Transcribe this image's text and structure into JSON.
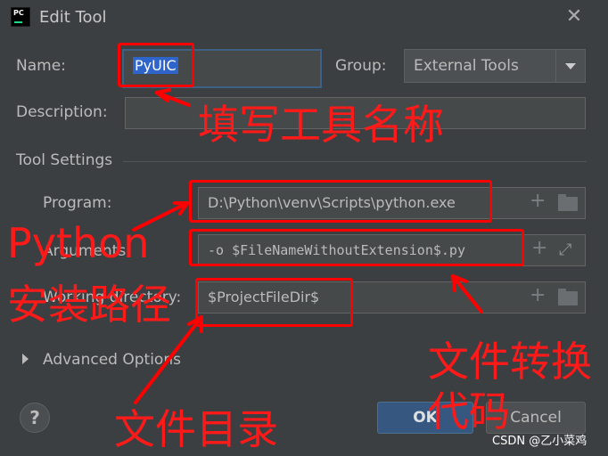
{
  "window": {
    "title": "Edit Tool",
    "close_glyph": "✕"
  },
  "form": {
    "name_label": "Name:",
    "name_value": "PyUIC",
    "group_label": "Group:",
    "group_value": "External Tools",
    "description_label": "Description:",
    "description_value": "",
    "section_title": "Tool Settings",
    "program_label": "Program:",
    "program_value": "D:\\Python\\venv\\Scripts\\python.exe",
    "arguments_label": "Arguments:",
    "arguments_value": "-o $FileNameWithoutExtension$.py",
    "workdir_label": "Working directory:",
    "workdir_value": "$ProjectFileDir$",
    "advanced_label": "Advanced Options"
  },
  "buttons": {
    "help": "?",
    "ok": "OK",
    "cancel": "Cancel"
  },
  "annotations": {
    "name_hint": "填写工具名称",
    "python_line1": "Python",
    "python_line2": "安装路径",
    "convert_line1": "文件转换",
    "convert_line2": "代码",
    "dir_hint": "文件目录"
  },
  "watermark": "CSDN @乙小菜鸡",
  "colors": {
    "background": "#3c3f41",
    "annotation": "#ff0000",
    "selection": "#2f65ca"
  },
  "icons": [
    "pycharm-app-icon",
    "close-icon",
    "add-icon",
    "folder-icon",
    "expand-icon",
    "chevron-down-icon",
    "expand-triangle-icon",
    "help-icon"
  ]
}
